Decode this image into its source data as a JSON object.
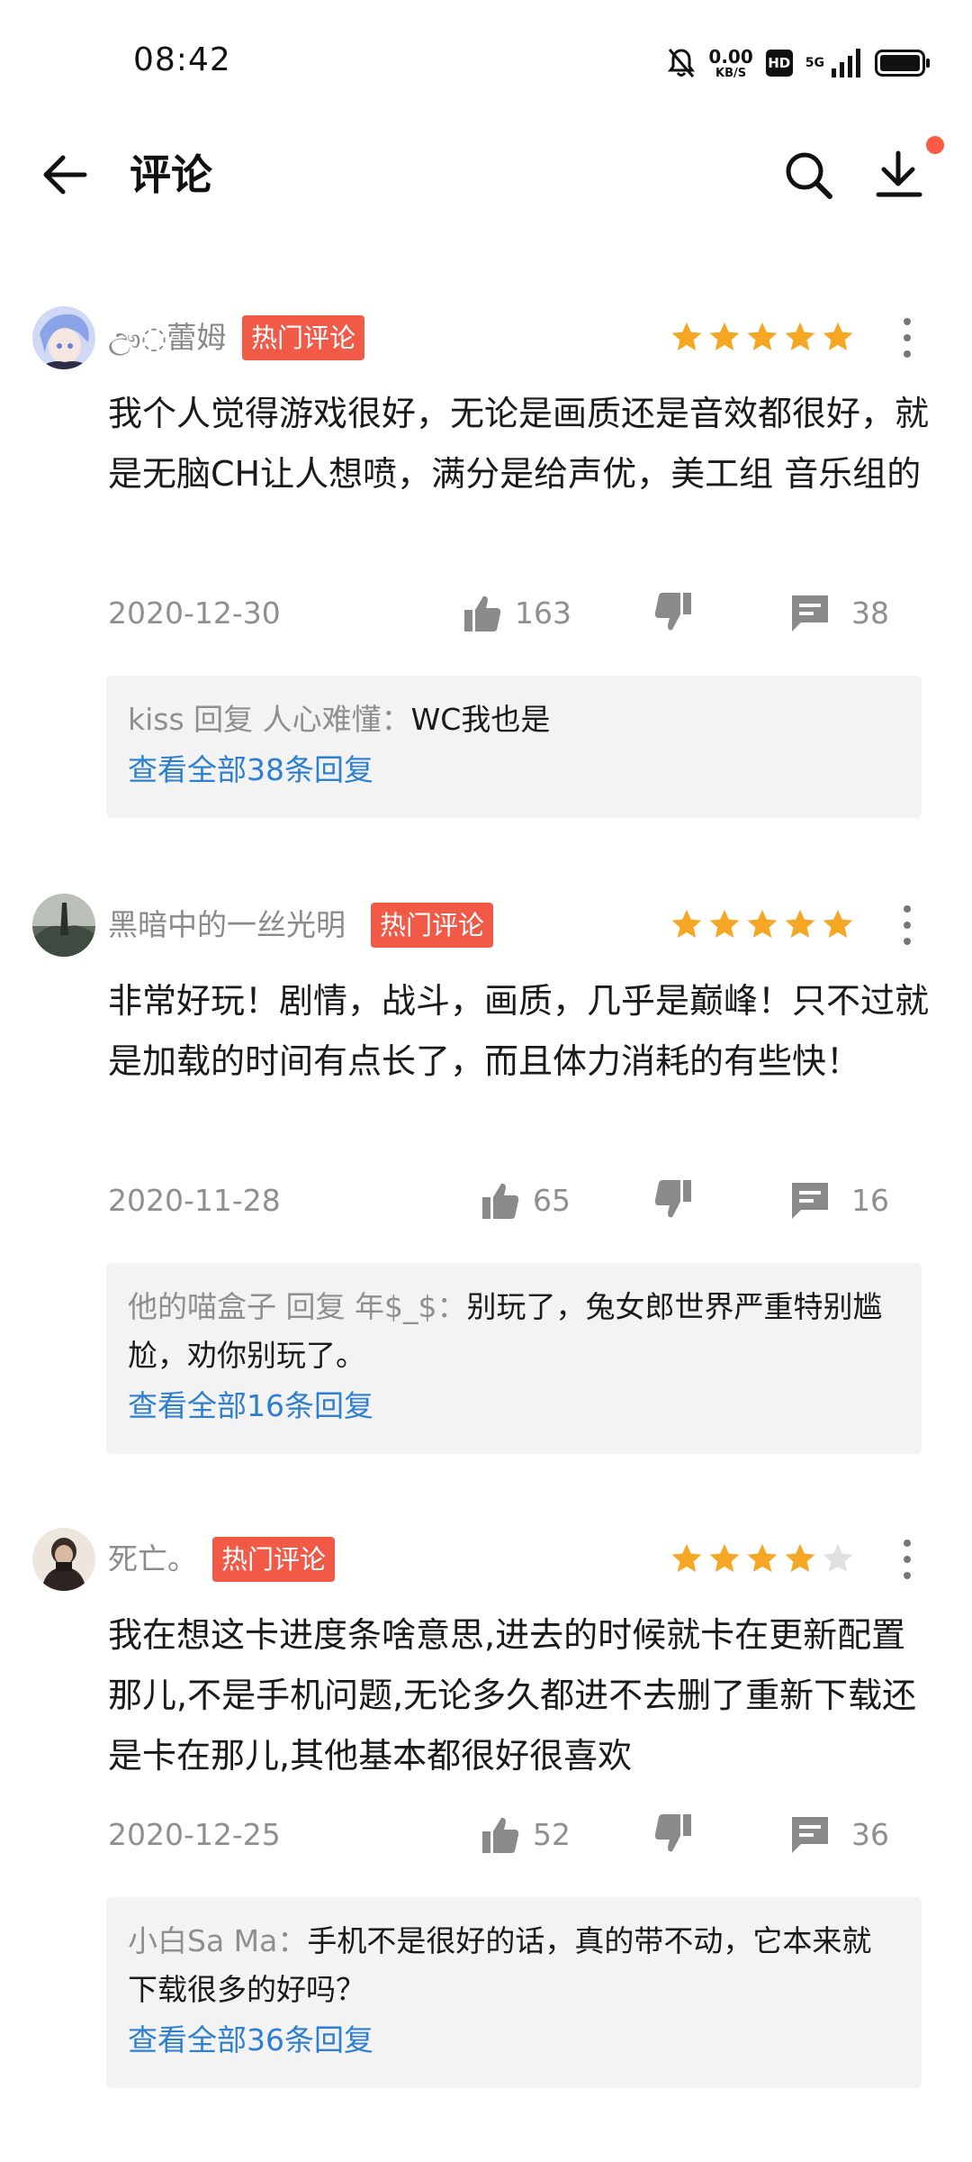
{
  "status_bar": {
    "time": "08:42",
    "net_speed_value": "0.00",
    "net_speed_unit": "KB/S",
    "hd_label": "HD",
    "network_label": "5G",
    "icons": [
      "bell-off-icon",
      "signal-icon",
      "battery-icon"
    ]
  },
  "header": {
    "title": "评论",
    "icons": [
      "back-arrow-icon",
      "search-icon",
      "download-icon"
    ]
  },
  "colors": {
    "accent_badge": "#f25a48",
    "star_filled": "#f5a623",
    "star_empty": "#e0e0e0",
    "link": "#2f7fd0",
    "secondary_text": "#8f8f8f"
  },
  "reviews": [
    {
      "user": "ඌ◌蕾姆",
      "badge": "热门评论",
      "rating": 5,
      "text": "我个人觉得游戏很好，无论是画质还是音效都很好，就是无脑CH让人想喷，满分是给声优，美工组 音乐组的",
      "date": "2020-12-30",
      "likes": "163",
      "replies": "38",
      "reply_preview": {
        "author": "kiss 回复 人心难懂：",
        "content": "WC我也是",
        "view_all": "查看全部38条回复"
      }
    },
    {
      "user": "黑暗中的一丝光明",
      "badge": "热门评论",
      "rating": 5,
      "text": "非常好玩！剧情，战斗，画质，几乎是巅峰！只不过就是加载的时间有点长了，而且体力消耗的有些快！",
      "date": "2020-11-28",
      "likes": "65",
      "replies": "16",
      "reply_preview": {
        "author": "他的喵盒子 回复 年$_$：",
        "content": "别玩了，兔女郎世界严重特别尴尬，劝你别玩了。",
        "view_all": "查看全部16条回复"
      }
    },
    {
      "user": "死亡。",
      "badge": "热门评论",
      "rating": 4,
      "text": "我在想这卡进度条啥意思,进去的时候就卡在更新配置那儿,不是手机问题,无论多久都进不去删了重新下载还是卡在那儿,其他基本都很好很喜欢",
      "date": "2020-12-25",
      "likes": "52",
      "replies": "36",
      "reply_preview": {
        "author": "小白Sa Ma：",
        "content": "手机不是很好的话，真的带不动，它本来就下载很多的好吗？",
        "view_all": "查看全部36条回复"
      }
    }
  ]
}
